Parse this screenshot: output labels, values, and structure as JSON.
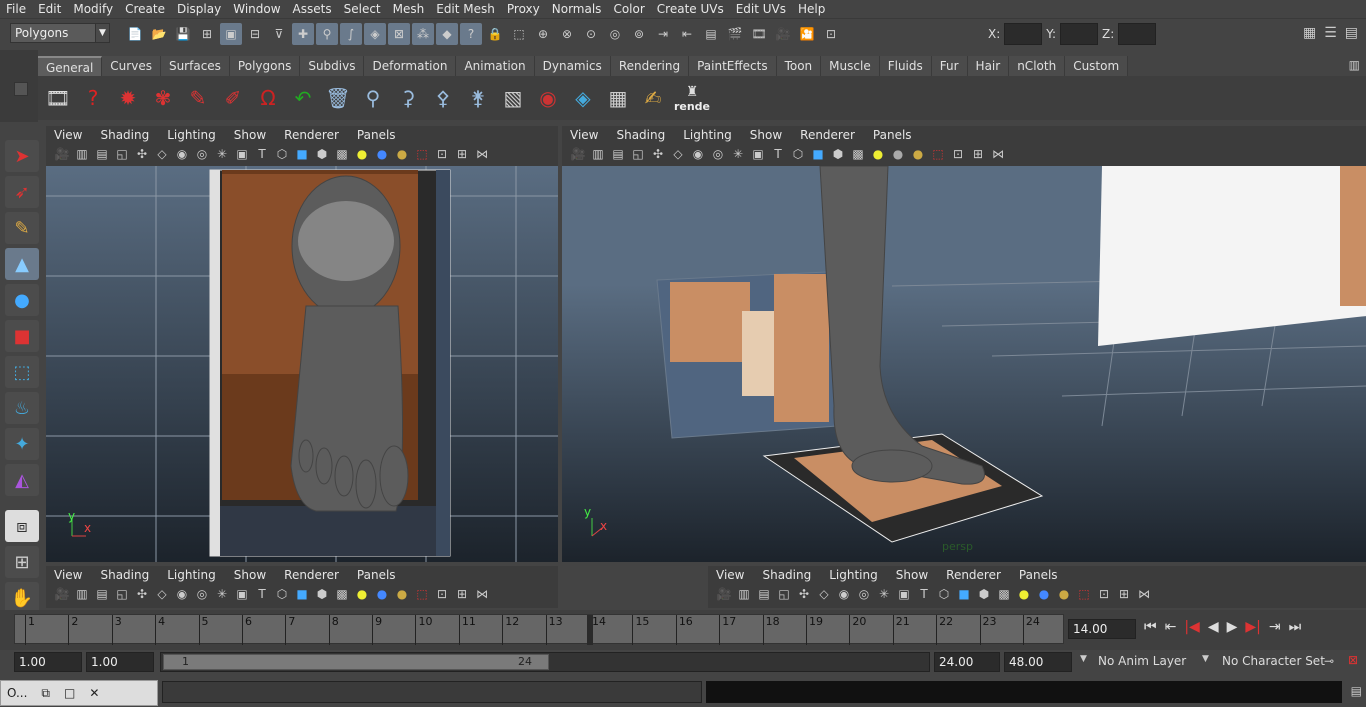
{
  "menu": [
    "File",
    "Edit",
    "Modify",
    "Create",
    "Display",
    "Window",
    "Assets",
    "Select",
    "Mesh",
    "Edit Mesh",
    "Proxy",
    "Normals",
    "Color",
    "Create UVs",
    "Edit UVs",
    "Help"
  ],
  "status_line": {
    "mode": "Polygons",
    "x_label": "X:",
    "y_label": "Y:",
    "z_label": "Z:"
  },
  "shelf": {
    "tabs": [
      "General",
      "Curves",
      "Surfaces",
      "Polygons",
      "Subdivs",
      "Deformation",
      "Animation",
      "Dynamics",
      "Rendering",
      "PaintEffects",
      "Toon",
      "Muscle",
      "Fluids",
      "Fur",
      "Hair",
      "nCloth",
      "Custom"
    ],
    "active_tab": "General",
    "last_item_label": "rende"
  },
  "panel_menu": [
    "View",
    "Shading",
    "Lighting",
    "Show",
    "Renderer",
    "Panels"
  ],
  "viewports": {
    "front": {
      "axis_y": "y",
      "axis_x": "x"
    },
    "persp": {
      "axis_y": "y",
      "axis_x": "x",
      "camera_label": "persp"
    }
  },
  "timeline": {
    "ticks": [
      "1",
      "2",
      "3",
      "4",
      "5",
      "6",
      "7",
      "8",
      "9",
      "10",
      "11",
      "12",
      "13",
      "14",
      "15",
      "16",
      "17",
      "18",
      "19",
      "20",
      "21",
      "22",
      "23",
      "24"
    ],
    "current_frame": "14.00"
  },
  "range": {
    "start": "1.00",
    "playback_start": "1.00",
    "slider_start": "1",
    "slider_end": "24",
    "playback_end": "24.00",
    "end": "48.00",
    "anim_layer": "No Anim Layer",
    "character_set": "No Character Set"
  },
  "taskbar": {
    "item_label": "O..."
  },
  "colors": {
    "viewport_top": "#5a6d82",
    "viewport_bottom": "#1c232b",
    "skin": "#c98e64",
    "mesh": "#5c5c5c"
  }
}
